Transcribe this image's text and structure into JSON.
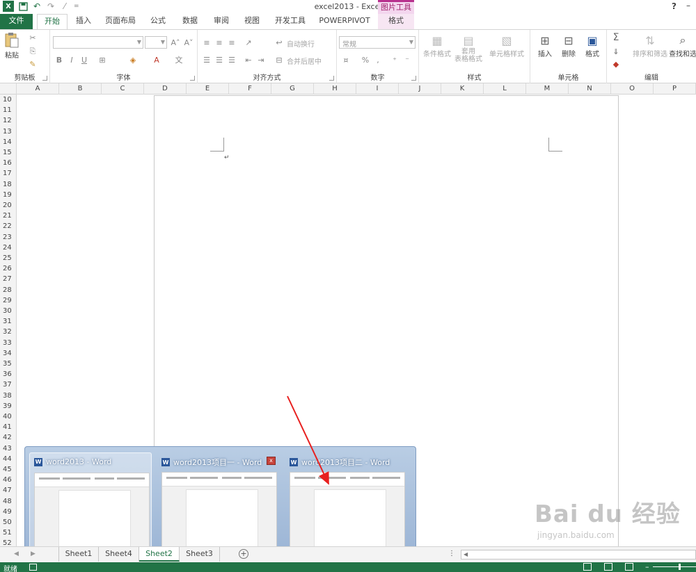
{
  "window": {
    "title": "excel2013 - Excel",
    "contextual_group": "图片工具",
    "help": "?",
    "minimize": "–"
  },
  "qat": {
    "customize": "="
  },
  "tabs": {
    "file": "文件",
    "items": [
      "开始",
      "插入",
      "页面布局",
      "公式",
      "数据",
      "审阅",
      "视图",
      "开发工具",
      "POWERPIVOT"
    ],
    "format": "格式"
  },
  "ribbon": {
    "clipboard": {
      "label": "剪贴板",
      "paste": "粘贴"
    },
    "font": {
      "label": "字体"
    },
    "alignment": {
      "label": "对齐方式",
      "wrap": "自动换行",
      "merge": "合并后居中"
    },
    "number": {
      "label": "数字",
      "format_value": "常规"
    },
    "styles": {
      "label": "样式",
      "cond_format": "条件格式",
      "table_format": "套用\n表格格式",
      "cell_styles": "单元格样式"
    },
    "cells": {
      "label": "单元格",
      "insert": "插入",
      "delete": "删除",
      "format": "格式"
    },
    "editing": {
      "label": "编辑",
      "sort_filter": "排序和筛选",
      "find_select": "查找和选"
    }
  },
  "columns": [
    "A",
    "B",
    "C",
    "D",
    "E",
    "F",
    "G",
    "H",
    "I",
    "J",
    "K",
    "L",
    "M",
    "N",
    "O",
    "P"
  ],
  "rows": [
    "10",
    "11",
    "12",
    "13",
    "14",
    "15",
    "16",
    "17",
    "18",
    "19",
    "20",
    "21",
    "22",
    "23",
    "24",
    "25",
    "26",
    "27",
    "28",
    "29",
    "30",
    "31",
    "32",
    "33",
    "34",
    "35",
    "36",
    "37",
    "38",
    "39",
    "40",
    "41",
    "42",
    "43",
    "44",
    "45",
    "46",
    "47",
    "48",
    "49",
    "50",
    "51",
    "52"
  ],
  "embedded_doc": {
    "paragraph_mark": "↵"
  },
  "taskbar_thumbnails": [
    {
      "title": "word2013 - Word",
      "icon": "word-icon",
      "hover": true
    },
    {
      "title": "word2013项目一 - Word",
      "icon": "word-icon",
      "close": "x"
    },
    {
      "title": "word2013项目二 - Word",
      "icon": "word-icon"
    }
  ],
  "sheet_tabs": {
    "items": [
      "Sheet1",
      "Sheet4",
      "Sheet2",
      "Sheet3"
    ],
    "active": "Sheet2",
    "add": "+"
  },
  "status": {
    "text": "就绪"
  },
  "watermark": {
    "main": "Bai du 经验",
    "sub": "jingyan.baidu.com"
  },
  "colors": {
    "excel_green": "#217346",
    "word_blue": "#2b579a",
    "picture_tools": "#b8318e",
    "arrow": "#e8201f"
  }
}
